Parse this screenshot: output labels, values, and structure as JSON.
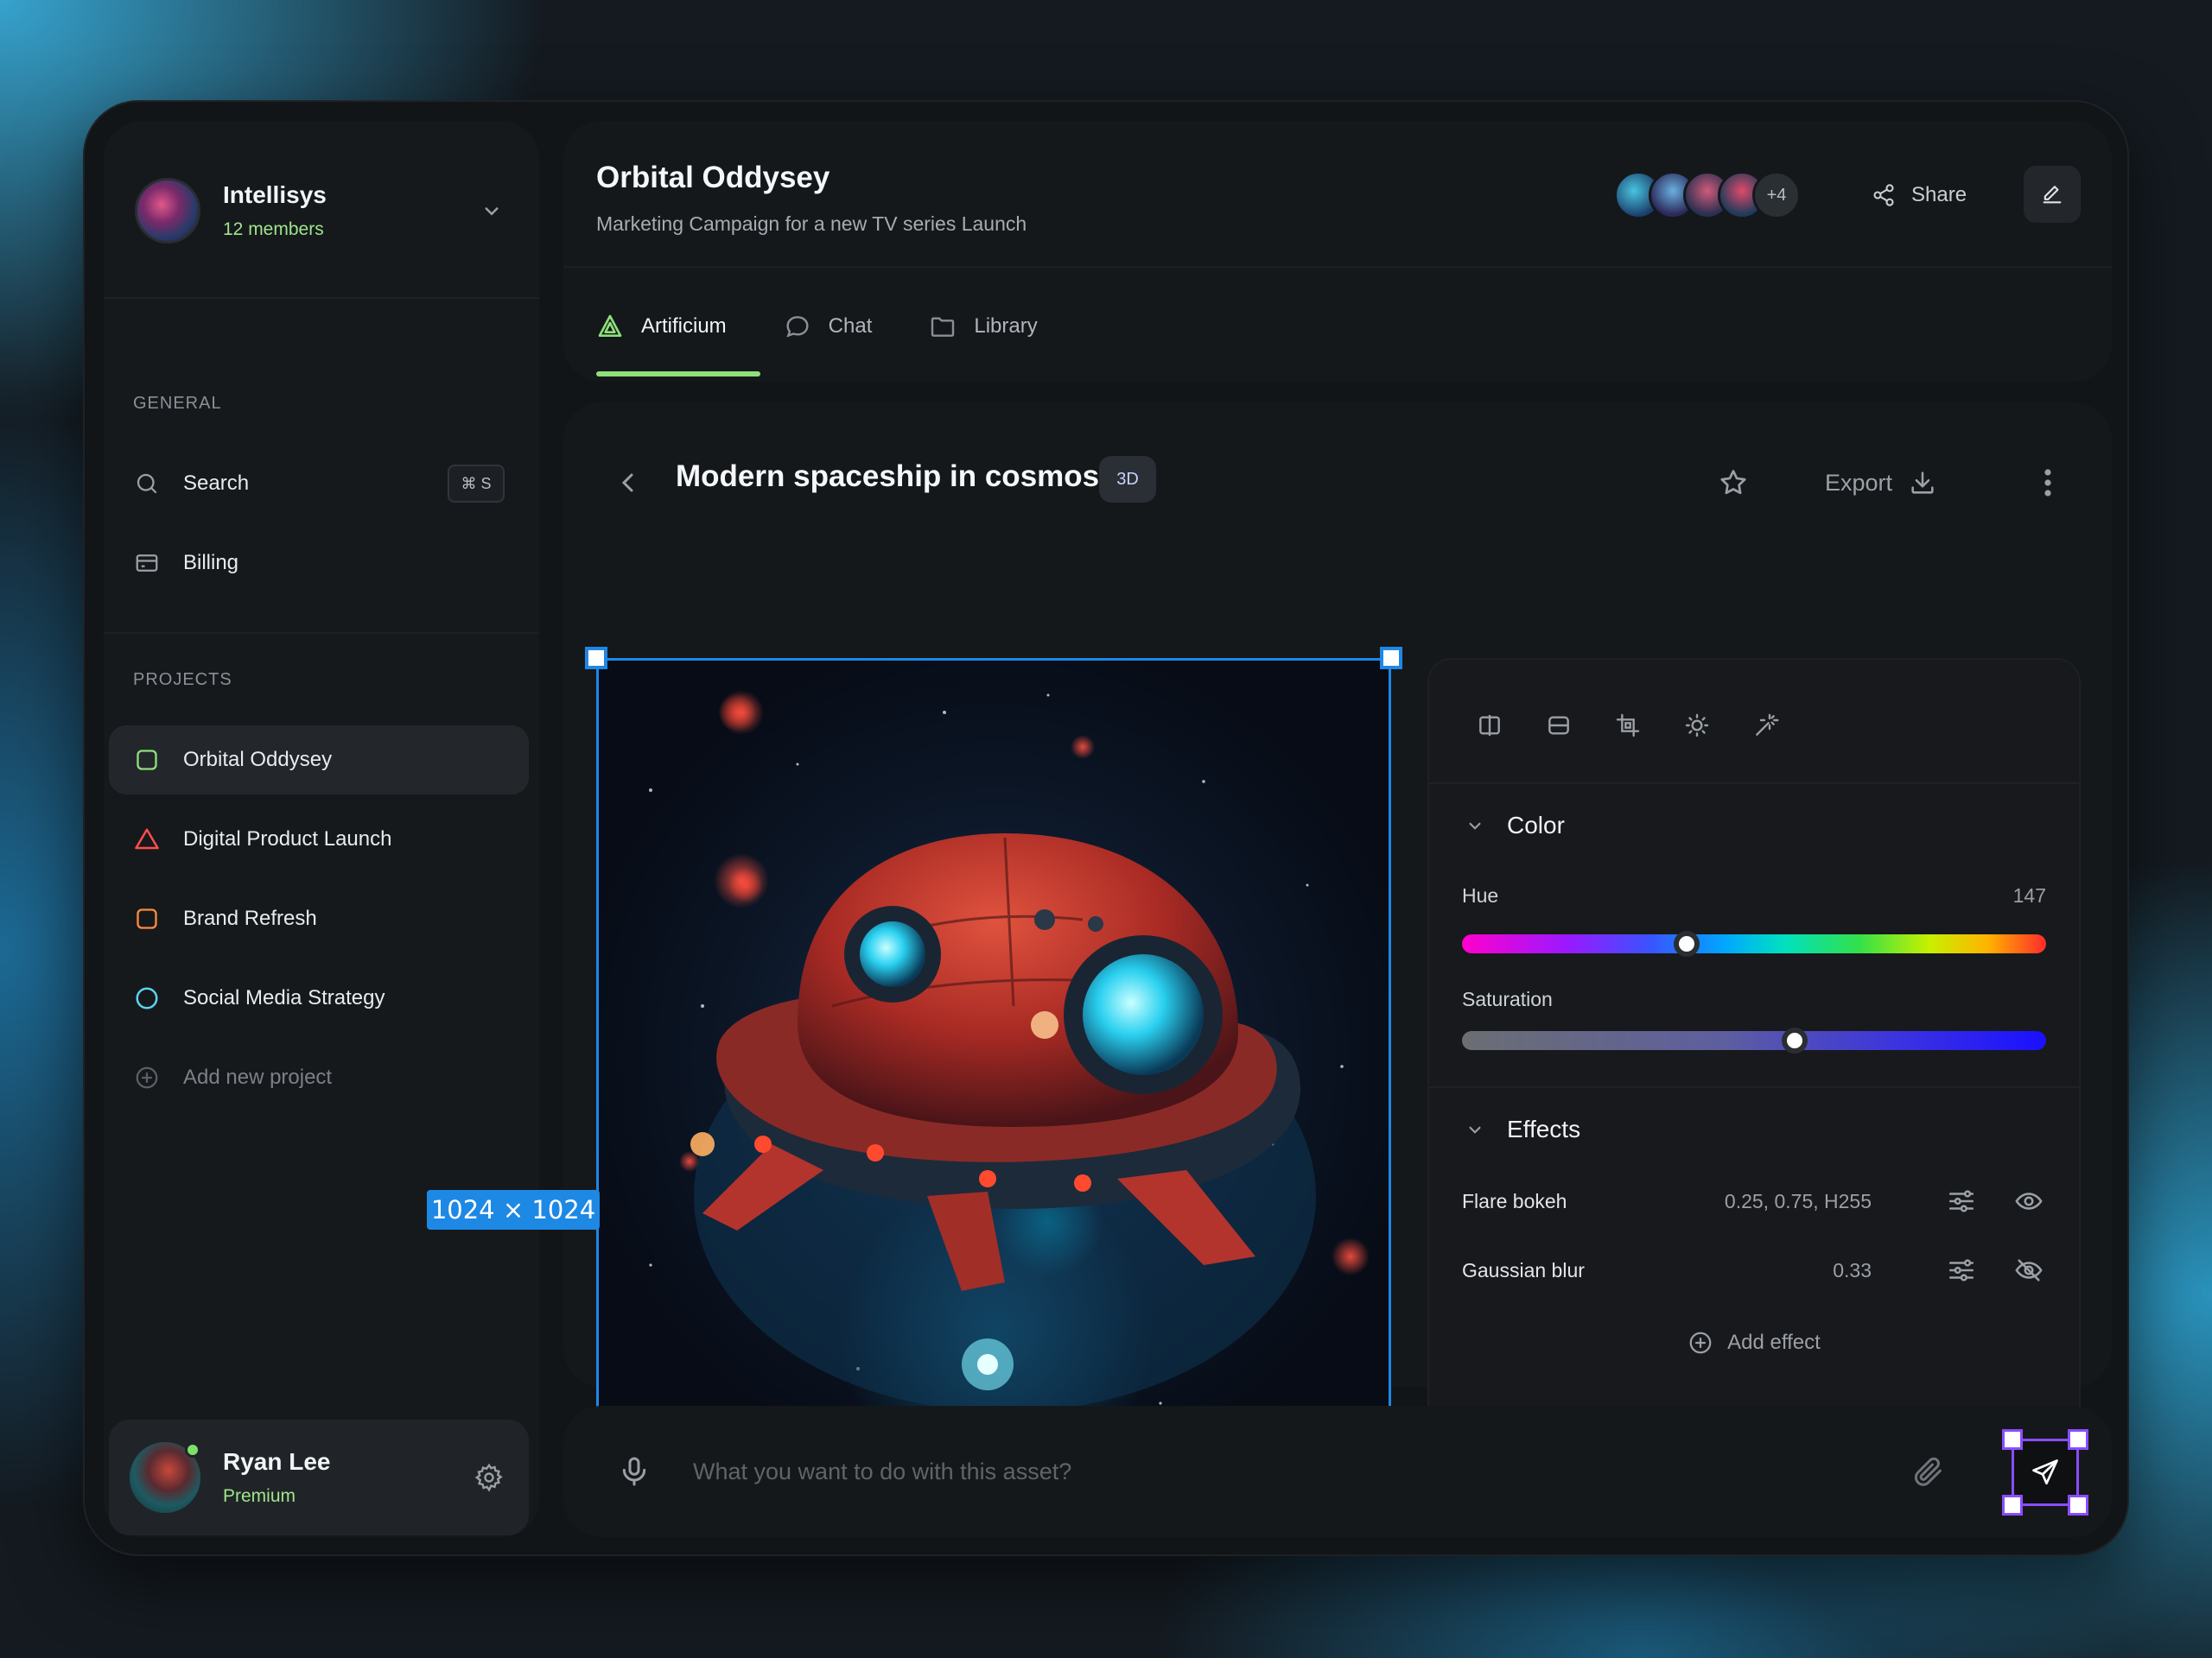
{
  "workspace": {
    "name": "Intellisys",
    "members": "12 members"
  },
  "sidebar": {
    "general_label": "GENERAL",
    "search_label": "Search",
    "search_shortcut": "⌘ S",
    "billing_label": "Billing",
    "projects_label": "PROJECTS",
    "projects": [
      {
        "name": "Orbital Oddysey",
        "color": "#8de07a",
        "shape": "square",
        "active": true
      },
      {
        "name": "Digital Product Launch",
        "color": "#ff4d4d",
        "shape": "triangle",
        "active": false
      },
      {
        "name": "Brand Refresh",
        "color": "#ff8a3d",
        "shape": "square",
        "active": false
      },
      {
        "name": "Social Media Strategy",
        "color": "#5ad6f0",
        "shape": "circle",
        "active": false
      }
    ],
    "add_project_label": "Add new project"
  },
  "user": {
    "name": "Ryan Lee",
    "plan": "Premium"
  },
  "header": {
    "title": "Orbital Oddysey",
    "subtitle": "Marketing Campaign for a new TV series Launch",
    "collaborators_more": "+4",
    "share_label": "Share"
  },
  "tabs": [
    {
      "label": "Artificium",
      "icon": "artificium-icon",
      "active": true
    },
    {
      "label": "Chat",
      "icon": "chat-icon",
      "active": false
    },
    {
      "label": "Library",
      "icon": "folder-icon",
      "active": false
    }
  ],
  "asset": {
    "title": "Modern spaceship in cosmos",
    "badge": "3D",
    "export_label": "Export",
    "dimensions": "1024 × 1024"
  },
  "panel": {
    "tools": [
      "flip-icon",
      "align-icon",
      "crop-icon",
      "brightness-icon",
      "magic-wand-icon"
    ],
    "color": {
      "title": "Color",
      "hue_label": "Hue",
      "hue_value": "147",
      "hue_fraction": 0.385,
      "saturation_label": "Saturation",
      "saturation_fraction": 0.57
    },
    "effects": {
      "title": "Effects",
      "items": [
        {
          "name": "Flare bokeh",
          "value": "0.25, 0.75, H255",
          "visible": true
        },
        {
          "name": "Gaussian blur",
          "value": "0.33",
          "visible": false
        }
      ],
      "add_label": "Add effect"
    }
  },
  "prompt": {
    "placeholder": "What you want to do with this asset?"
  },
  "colors": {
    "accent_green": "#8de07a",
    "selection_blue": "#1e88e5",
    "send_purple": "#8a4dff"
  }
}
